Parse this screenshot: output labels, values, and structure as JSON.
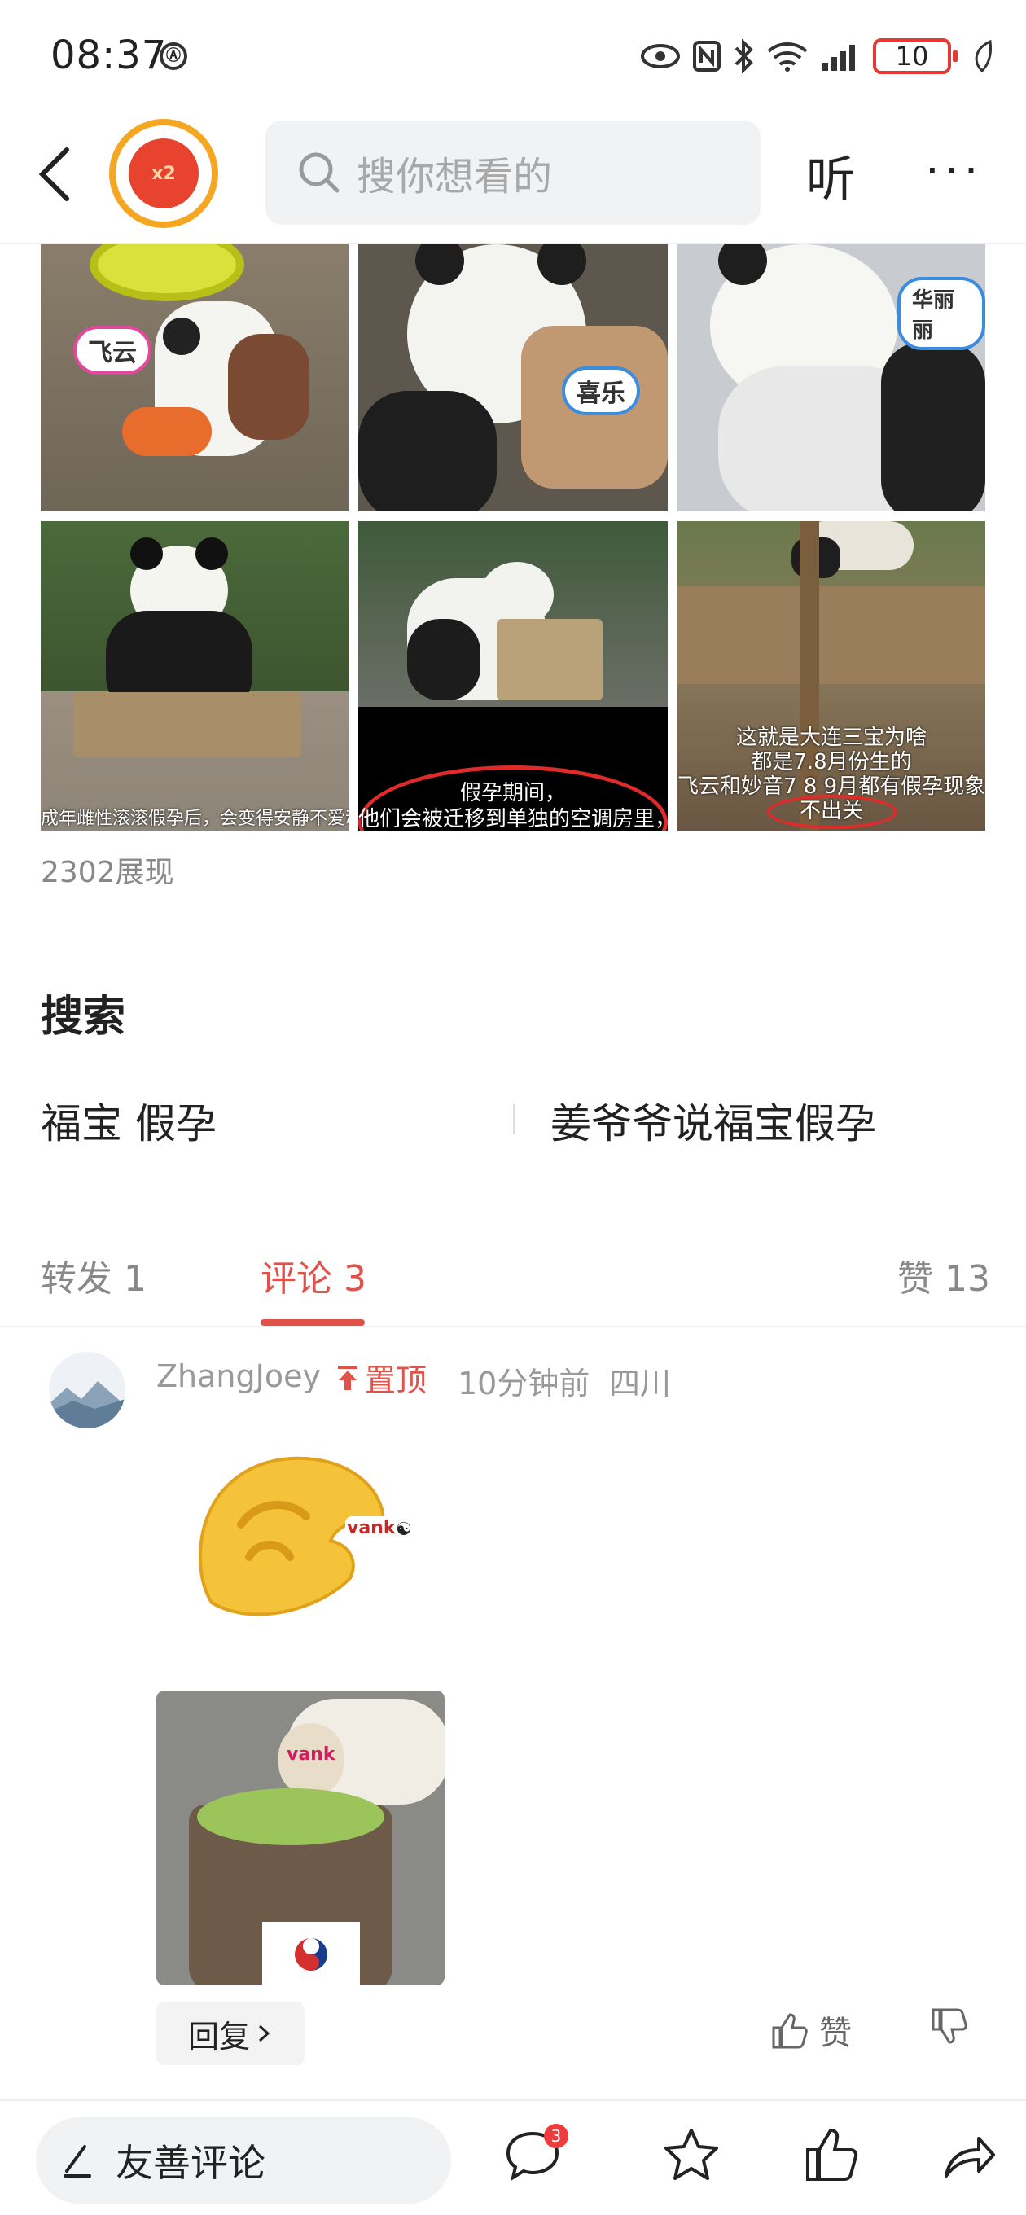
{
  "status_bar": {
    "time": "08:37",
    "battery": "10"
  },
  "header": {
    "avatar_badge": "x2",
    "search_placeholder": "搜你想看的",
    "listen_label": "听",
    "more_label": "···"
  },
  "grid": {
    "images": [
      {
        "tag": "飞云"
      },
      {
        "tag": "喜乐"
      },
      {
        "tag": "华丽丽"
      },
      {
        "caption": "成年雌性滚滚假孕后，会变得安静不爱动"
      },
      {
        "caption_line1": "假孕期间，",
        "caption_line2": "他们会被迁移到单独的空调房里，"
      },
      {
        "caption_line1": "这就是大连三宝为啥",
        "caption_line2": "都是7.8月份生的",
        "caption_line3": "飞云和妙音7 8 9月都有假孕现象",
        "caption_line4": "不出关"
      }
    ],
    "views": "2302展现"
  },
  "search_section": {
    "title": "搜索",
    "terms": [
      "福宝 假孕",
      "姜爷爷说福宝假孕"
    ]
  },
  "tabs": [
    {
      "label": "转发 1"
    },
    {
      "label": "评论 3"
    },
    {
      "label": "赞 13"
    }
  ],
  "comment": {
    "user": "ZhangJoey",
    "pinned": "置顶",
    "time": "10分钟前",
    "location": "四川",
    "sticker1_text": "vank",
    "sticker2_text": "vank",
    "reply_label": "回复",
    "like_label": "赞"
  },
  "bottom_bar": {
    "input_placeholder": "友善评论",
    "comment_badge": "3"
  },
  "colors": {
    "accent": "#e0524a",
    "avatar_ring": "#f5a623",
    "battery": "#e53935"
  }
}
